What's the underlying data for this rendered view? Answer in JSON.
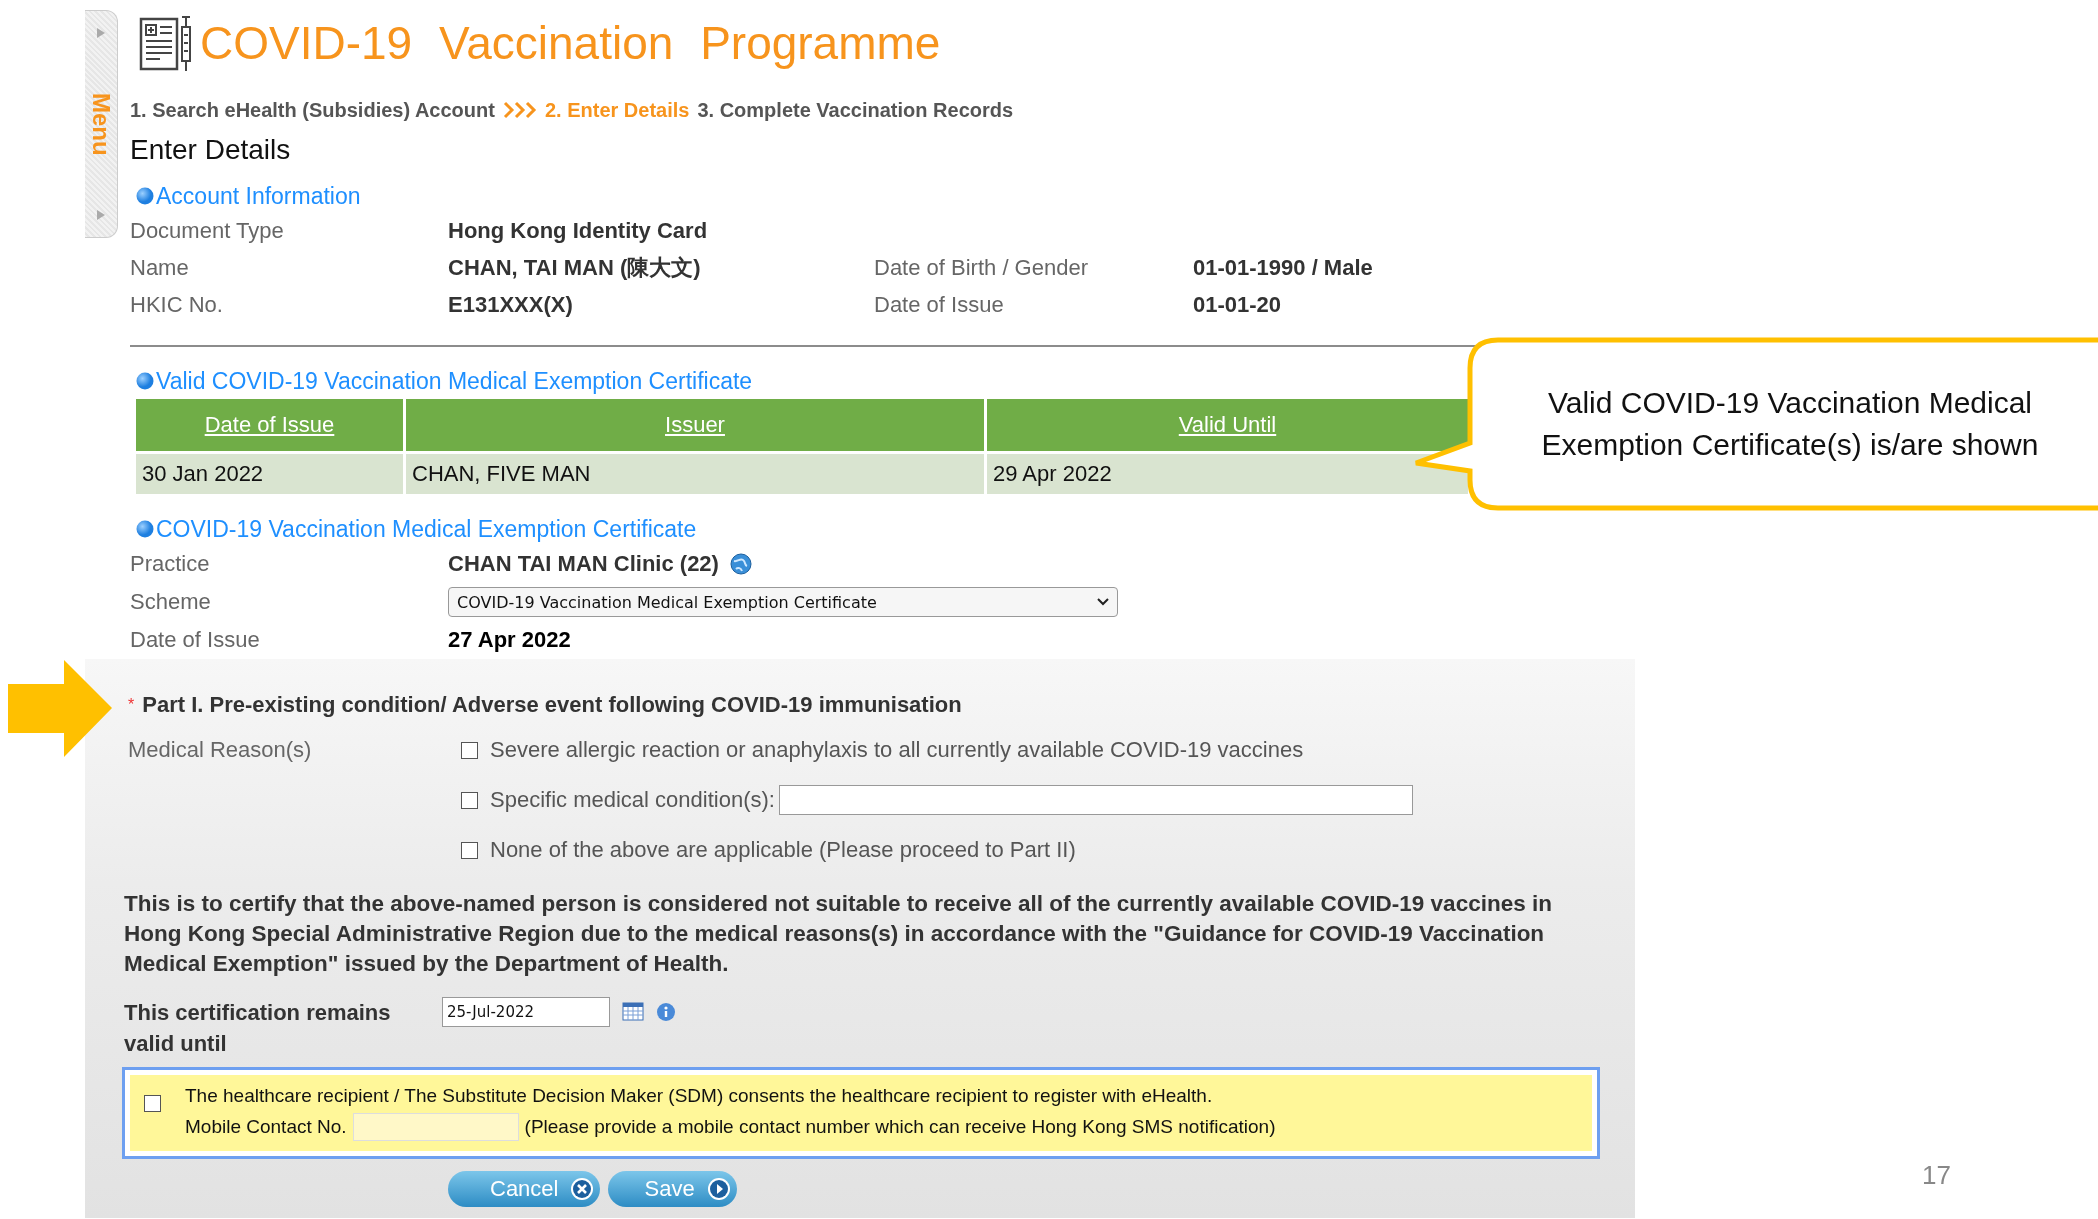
{
  "menu_tab": {
    "label": "Menu"
  },
  "header": {
    "title": "COVID-19 Vaccination Programme"
  },
  "steps": [
    {
      "label": "1. Search eHealth (Subsidies) Account",
      "selected": false
    },
    {
      "label": "2. Enter Details",
      "selected": true
    },
    {
      "label": "3. Complete Vaccination Records",
      "selected": false
    }
  ],
  "page_title": "Enter Details",
  "account_information": {
    "heading": "Account Information",
    "rows": [
      {
        "fields": [
          {
            "label": "Document Type",
            "value": "Hong Kong Identity Card"
          }
        ]
      },
      {
        "fields": [
          {
            "label": "Name",
            "value": "CHAN, TAI MAN (陳大文)"
          },
          {
            "label": "Date of Birth / Gender",
            "value": "01-01-1990 / Male"
          }
        ]
      },
      {
        "fields": [
          {
            "label": "HKIC No.",
            "value": "E131XXX(X)"
          },
          {
            "label": "Date of Issue",
            "value": "01-01-20"
          }
        ]
      }
    ]
  },
  "valid_certificates": {
    "heading": "Valid COVID-19 Vaccination Medical Exemption Certificate",
    "columns": [
      "Date of Issue",
      "Issuer",
      "Valid Until"
    ],
    "rows": [
      [
        "30 Jan 2022",
        "CHAN, FIVE MAN",
        "29 Apr 2022"
      ]
    ]
  },
  "exemption_certificate": {
    "heading": "COVID-19 Vaccination Medical Exemption Certificate",
    "practice": {
      "label": "Practice",
      "value": "CHAN TAI MAN Clinic (22)"
    },
    "scheme": {
      "label": "Scheme",
      "value": "COVID-19 Vaccination Medical Exemption Certificate"
    },
    "date_of_issue": {
      "label": "Date of Issue",
      "value": "27 Apr 2022"
    }
  },
  "part_one": {
    "required_mark": "*",
    "heading": "Part I. Pre-existing condition/ Adverse event following COVID-19 immunisation",
    "label": "Medical Reason(s)",
    "options": [
      {
        "kind": "checkbox",
        "label": "Severe allergic reaction or anaphylaxis to all currently available COVID-19 vaccines",
        "checked": false
      },
      {
        "kind": "checkbox_field",
        "label": "Specific medical condition(s):",
        "checked": false
      },
      {
        "kind": "checkbox",
        "label": "None of the above are applicable (Please proceed to Part II)",
        "checked": false
      }
    ]
  },
  "certification": {
    "statement": "This is to certify that the above-named person is considered not suitable to receive all of the currently available COVID-19 vaccines in Hong Kong Special Administrative Region due to the medical reasons(s) in accordance with the \"Guidance for COVID-19 Vaccination Medical Exemption\" issued by the Department of Health.",
    "valid_until_label": "This certification remains valid until",
    "valid_until_value": "25-Jul-2022"
  },
  "consent": {
    "checked": false,
    "text": "The healthcare recipient / The Substitute Decision Maker (SDM) consents the healthcare recipient to register with eHealth.",
    "mobile_label": "Mobile Contact No.",
    "mobile_note": "(Please provide a mobile contact number which can receive Hong Kong SMS notification)"
  },
  "buttons": [
    {
      "kind": "cancel",
      "label": "Cancel"
    },
    {
      "kind": "save",
      "label": "Save"
    }
  ],
  "callout": {
    "text": "Valid COVID-19 Vaccination Medical Exemption Certificate(s) is/are shown"
  },
  "slide_number": "17"
}
